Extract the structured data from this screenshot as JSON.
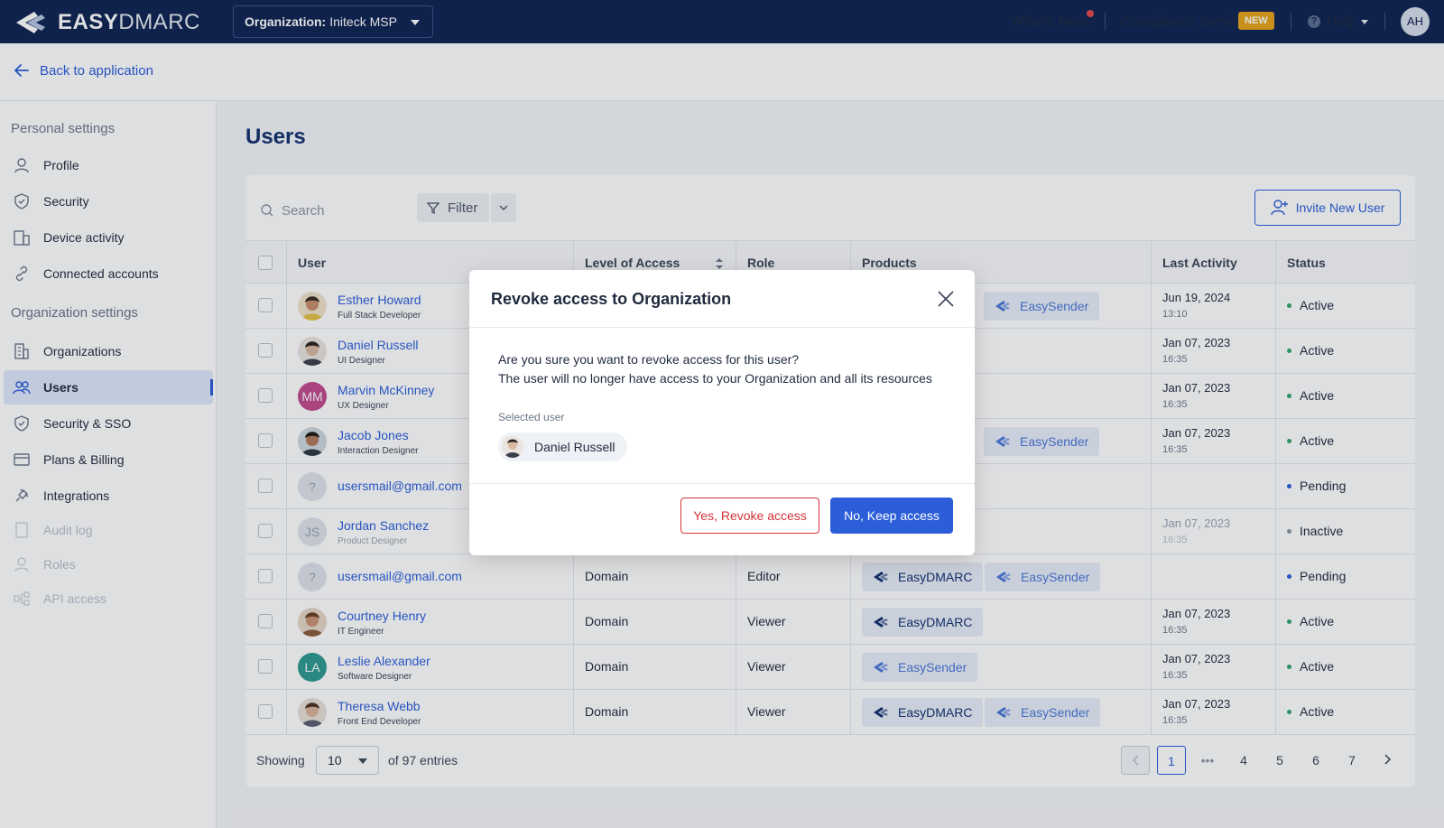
{
  "topbar": {
    "brand_bold": "EASY",
    "brand_light": "DMARC",
    "org_label": "Organization:",
    "org_value": "Initeck MSP",
    "whats_new": "What's New?",
    "compliance": "Compliance Service",
    "new_badge": "NEW",
    "help": "Help",
    "avatar_initials": "AH"
  },
  "back_link": "Back to application",
  "sidebar": {
    "personal_title": "Personal settings",
    "personal": [
      {
        "label": "Profile",
        "icon": "user-icon"
      },
      {
        "label": "Security",
        "icon": "shield-check-icon"
      },
      {
        "label": "Device activity",
        "icon": "devices-icon"
      },
      {
        "label": "Connected accounts",
        "icon": "link-icon"
      }
    ],
    "org_title": "Organization settings",
    "org": [
      {
        "label": "Organizations",
        "icon": "building-icon"
      },
      {
        "label": "Users",
        "icon": "users-icon",
        "active": true
      },
      {
        "label": "Security & SSO",
        "icon": "shield-check-icon"
      },
      {
        "label": "Plans & Billing",
        "icon": "credit-card-icon"
      },
      {
        "label": "Integrations",
        "icon": "plug-icon"
      },
      {
        "label": "Audit log",
        "icon": "doc-icon",
        "disabled": true
      },
      {
        "label": "Roles",
        "icon": "user-icon",
        "disabled": true
      },
      {
        "label": "API access",
        "icon": "api-icon",
        "disabled": true
      }
    ]
  },
  "main": {
    "title": "Users",
    "search_placeholder": "Search",
    "filter_label": "Filter",
    "invite_label": "Invite New User",
    "columns": {
      "user": "User",
      "access": "Level of Access",
      "role": "Role",
      "products": "Products",
      "activity": "Last Activity",
      "status": "Status"
    },
    "rows": [
      {
        "name": "Esther Howard",
        "title": "Full Stack Developer",
        "access": "",
        "role": "",
        "products": [
          "EasySender"
        ],
        "date": "Jun 19, 2024",
        "time": "13:10",
        "status": "Active",
        "avatar": "photo"
      },
      {
        "name": "Daniel Russell",
        "title": "UI Designer",
        "access": "",
        "role": "",
        "products": [],
        "date": "Jan 07, 2023",
        "time": "16:35",
        "status": "Active",
        "avatar": "photo"
      },
      {
        "name": "Marvin McKinney",
        "title": "UX Designer",
        "access": "",
        "role": "",
        "products": [],
        "date": "Jan 07, 2023",
        "time": "16:35",
        "status": "Active",
        "avatar": "MM"
      },
      {
        "name": "Jacob Jones",
        "title": "Interaction Designer",
        "access": "",
        "role": "",
        "products": [
          "EasySender"
        ],
        "date": "Jan 07, 2023",
        "time": "16:35",
        "status": "Active",
        "avatar": "photo"
      },
      {
        "name": "usersmail@gmail.com",
        "title": "",
        "access": "",
        "role": "",
        "products": [],
        "date": "",
        "time": "",
        "status": "Pending",
        "avatar": "?"
      },
      {
        "name": "Jordan Sanchez",
        "title": "Product Designer",
        "access": "",
        "role": "",
        "products": [],
        "date": "Jan 07, 2023",
        "time": "16:35",
        "status": "Inactive",
        "avatar": "JS"
      },
      {
        "name": "usersmail@gmail.com",
        "title": "",
        "access": "Domain",
        "role": "Editor",
        "products": [
          "EasyDMARC",
          "EasySender"
        ],
        "date": "",
        "time": "",
        "status": "Pending",
        "avatar": "?"
      },
      {
        "name": "Courtney Henry",
        "title": "IT Engineer",
        "access": "Domain",
        "role": "Viewer",
        "products": [
          "EasyDMARC"
        ],
        "date": "Jan 07, 2023",
        "time": "16:35",
        "status": "Active",
        "avatar": "photo"
      },
      {
        "name": "Leslie Alexander",
        "title": "Software Designer",
        "access": "Domain",
        "role": "Viewer",
        "products": [
          "EasySender"
        ],
        "date": "Jan 07, 2023",
        "time": "16:35",
        "status": "Active",
        "avatar": "LA"
      },
      {
        "name": "Theresa Webb",
        "title": "Front End Developer",
        "access": "Domain",
        "role": "Viewer",
        "products": [
          "EasyDMARC",
          "EasySender"
        ],
        "date": "Jan 07, 2023",
        "time": "16:35",
        "status": "Active",
        "avatar": "photo"
      }
    ],
    "footer": {
      "showing": "Showing",
      "page_size": "10",
      "of_entries": "of 97 entries",
      "pages": [
        "1",
        "4",
        "5",
        "6",
        "7"
      ],
      "ellipsis": "•••"
    }
  },
  "modal": {
    "title": "Revoke access to Organization",
    "line1": "Are you sure you want to revoke access for this user?",
    "line2": "The user will no longer have access to your Organization and all its resources",
    "selected_label": "Selected user",
    "selected_user": "Daniel Russell",
    "revoke_label": "Yes, Revoke access",
    "keep_label": "No, Keep access"
  },
  "colors": {
    "nav_bg": "#0e2452",
    "accent": "#2c5ed9",
    "danger": "#d0343a",
    "badge": "#e6a318",
    "status_active": "#2fa36b",
    "status_pending": "#2c5ed9",
    "status_inactive": "#8a94a6"
  }
}
